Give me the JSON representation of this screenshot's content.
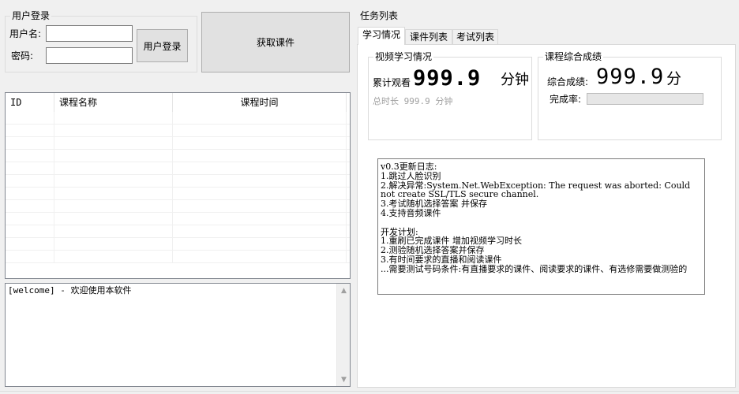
{
  "login": {
    "group_title": "用户登录",
    "username_label": "用户名:",
    "password_label": "密码:",
    "username_value": "",
    "password_value": "",
    "login_button": "用户登录"
  },
  "fetch_button": "获取课件",
  "course_table": {
    "columns": [
      "ID",
      "课程名称",
      "课程时间"
    ],
    "rows": []
  },
  "log": {
    "text": "[welcome] - 欢迎使用本软件"
  },
  "tasks": {
    "group_title": "任务列表",
    "tabs": [
      {
        "label": "学习情况",
        "active": true
      },
      {
        "label": "课件列表",
        "active": false
      },
      {
        "label": "考试列表",
        "active": false
      }
    ]
  },
  "video_study": {
    "group_title": "视频学习情况",
    "watched_label": "累计观看",
    "watched_value": "999.9",
    "watched_unit": "分钟",
    "total_text": "总时长 999.9 分钟"
  },
  "grades": {
    "group_title": "课程综合成绩",
    "score_label": "综合成绩:",
    "score_value": "999.9",
    "score_unit": "分",
    "completion_label": "完成率:",
    "completion_percent": 0
  },
  "changelog": {
    "lines": [
      "v0.3更新日志:",
      "1.跳过人脸识别",
      "2.解决异常:System.Net.WebException: The request was aborted: Could not create SSL/TLS secure channel.",
      "3.考试随机选择答案 并保存",
      "4.支持音频课件",
      "",
      "开发计划:",
      "1.重刷已完成课件 增加视频学习时长",
      "2.测验随机选择答案并保存",
      "3.有时间要求的直播和阅读课件",
      "...需要测试号码条件:有直播要求的课件、阅读要求的课件、有选修需要做测验的"
    ]
  },
  "colors": {
    "window_bg": "#f0f0f0",
    "progress_fill": "#06b025"
  }
}
